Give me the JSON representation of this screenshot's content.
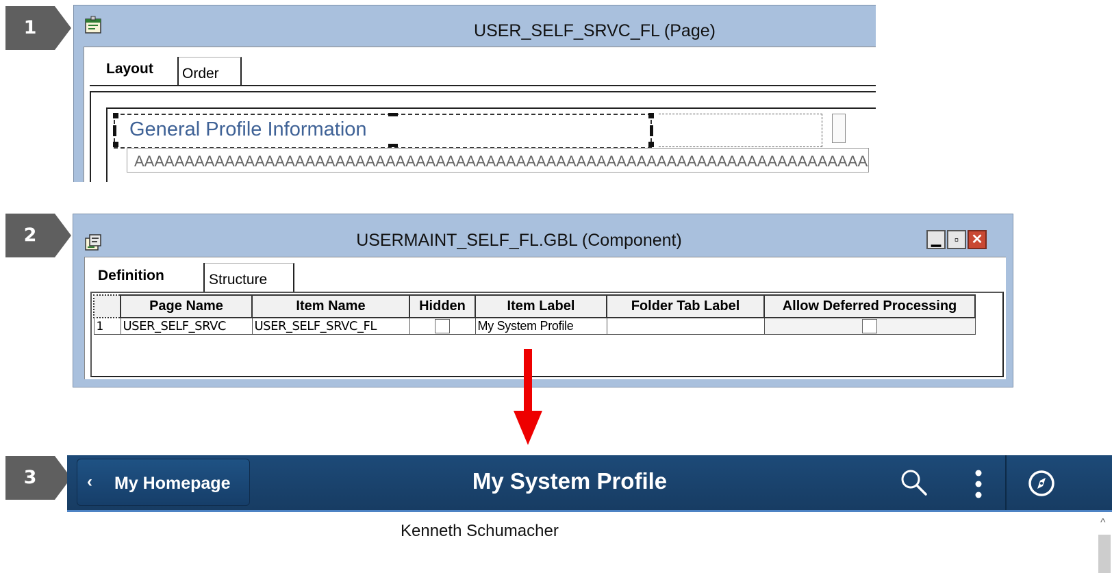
{
  "steps": [
    "1",
    "2",
    "3"
  ],
  "page_window": {
    "title": "USER_SELF_SRVC_FL (Page)",
    "tabs": [
      "Layout",
      "Order"
    ],
    "active_tab": "Layout",
    "group_box_label": "General Profile Information",
    "edit_field_placeholder": "AAAAAAAAAAAAAAAAAAAAAAAAAAAAAAAAAAAAAAAAAAAAAAAAAAAAAAAAAAAAAAAAAAAAAAAAAAAAAAAAAAAAAAAAAA"
  },
  "component_window": {
    "title": "USERMAINT_SELF_FL.GBL (Component)",
    "tabs": [
      "Definition",
      "Structure"
    ],
    "active_tab": "Definition",
    "window_buttons": [
      "minimize",
      "maximize",
      "close"
    ],
    "columns": [
      "Page Name",
      "Item Name",
      "Hidden",
      "Item Label",
      "Folder Tab Label",
      "Allow Deferred Processing"
    ],
    "rows": [
      {
        "row_number": "1",
        "page_name": "USER_SELF_SRVC",
        "item_name": "USER_SELF_SRVC_FL",
        "hidden": false,
        "item_label": "My System Profile",
        "folder_tab_label": "",
        "allow_deferred_processing": false
      }
    ]
  },
  "fluid_page": {
    "back_button_label": "My Homepage",
    "page_title": "My System Profile",
    "user_name": "Kenneth Schumacher",
    "icons": [
      "back-chevron-icon",
      "search-icon",
      "actions-menu-icon",
      "navbar-compass-icon"
    ]
  },
  "colors": {
    "step_badge": "#5f5f5f",
    "window_frame": "#a9c0dd",
    "group_label_text": "#3f6296",
    "fluid_banner": "#1a4570",
    "fluid_banner_border": "#4e83c4",
    "arrow": "#ee0000",
    "close_button": "#c94833"
  }
}
